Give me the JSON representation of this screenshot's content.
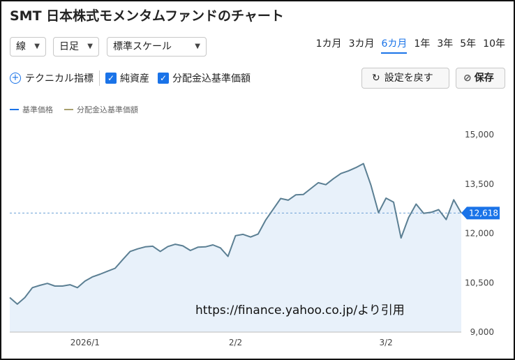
{
  "header": {
    "title": "SMT 日本株式モメンタムファンドのチャート"
  },
  "controls": {
    "chart_style": "線",
    "interval": "日足",
    "scale": "標準スケール",
    "periods": [
      "1カ月",
      "3カ月",
      "6カ月",
      "1年",
      "3年",
      "5年",
      "10年"
    ],
    "active_period": "6カ月"
  },
  "toolbar": {
    "technical_label": "テクニカル指標",
    "nav_label": "純資産",
    "dist_label": "分配金込基準価額",
    "reset_label": "設定を戻す",
    "save_label": "保存"
  },
  "colors": {
    "accent": "#1a73e8",
    "line": "#5b7f93",
    "fill": "#e8f1fa",
    "dist_line": "#a8a06e"
  },
  "chart_data": {
    "type": "area",
    "series": [
      {
        "name": "基準価格",
        "values": [
          10050,
          9850,
          10050,
          10350,
          10420,
          10480,
          10400,
          10400,
          10440,
          10350,
          10550,
          10680,
          10760,
          10850,
          10940,
          11200,
          11450,
          11530,
          11590,
          11610,
          11450,
          11600,
          11670,
          11620,
          11480,
          11580,
          11590,
          11650,
          11560,
          11300,
          11930,
          11970,
          11890,
          11980,
          12400,
          12730,
          13060,
          13010,
          13170,
          13180,
          13360,
          13540,
          13480,
          13660,
          13820,
          13900,
          14000,
          14120,
          13460,
          12630,
          13070,
          12950,
          11860,
          12480,
          12890,
          12610,
          12640,
          12720,
          12420,
          13020,
          12618
        ]
      },
      {
        "name": "分配金込基準価額",
        "values": []
      }
    ],
    "x_ticks": [
      "2026/1",
      "2/2",
      "3/2"
    ],
    "x_tick_index": [
      10,
      30,
      50
    ],
    "y_ticks": [
      9000,
      10500,
      12000,
      13500,
      15000
    ],
    "y_tick_labels": [
      "9,000",
      "10,500",
      "12,000",
      "13,500",
      "15,000"
    ],
    "ylim": [
      9000,
      15000
    ],
    "last_value": 12618,
    "last_value_label": "12,618",
    "grid": false,
    "legend": "top-left"
  },
  "watermark": "https://finance.yahoo.co.jp/より引用"
}
